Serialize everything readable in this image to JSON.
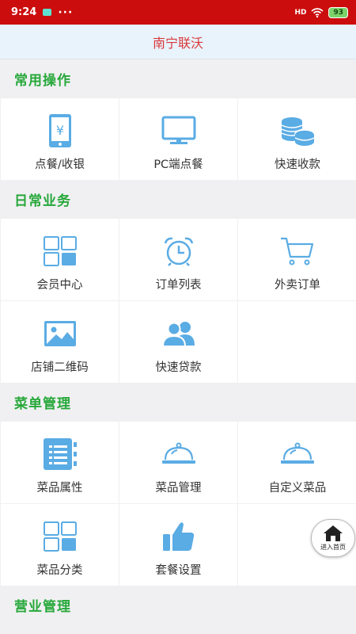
{
  "status_bar": {
    "time": "9:24",
    "dots": "···",
    "signal": "HD",
    "battery": "93"
  },
  "header": {
    "title": "南宁联沃"
  },
  "sections": [
    {
      "title": "常用操作",
      "items": [
        {
          "label": "点餐/收银",
          "icon": "phone-yen-icon"
        },
        {
          "label": "PC端点餐",
          "icon": "monitor-icon"
        },
        {
          "label": "快速收款",
          "icon": "coins-icon"
        }
      ]
    },
    {
      "title": "日常业务",
      "items": [
        {
          "label": "会员中心",
          "icon": "grid-icon"
        },
        {
          "label": "订单列表",
          "icon": "alarm-clock-icon"
        },
        {
          "label": "外卖订单",
          "icon": "cart-icon"
        },
        {
          "label": "店铺二维码",
          "icon": "image-icon"
        },
        {
          "label": "快速贷款",
          "icon": "users-icon"
        }
      ]
    },
    {
      "title": "菜单管理",
      "items": [
        {
          "label": "菜品属性",
          "icon": "notebook-icon"
        },
        {
          "label": "菜品管理",
          "icon": "cloche-icon"
        },
        {
          "label": "自定义菜品",
          "icon": "cloche-icon"
        },
        {
          "label": "菜品分类",
          "icon": "grid-icon"
        },
        {
          "label": "套餐设置",
          "icon": "thumbs-up-icon"
        }
      ]
    },
    {
      "title": "营业管理",
      "items": []
    }
  ],
  "floating_button": {
    "label": "进入首页",
    "icon": "home-icon"
  },
  "colors": {
    "status_bar": "#cc0d0d",
    "title_text": "#d9393b",
    "section_title": "#27a83a",
    "icon_blue": "#5aace4"
  }
}
